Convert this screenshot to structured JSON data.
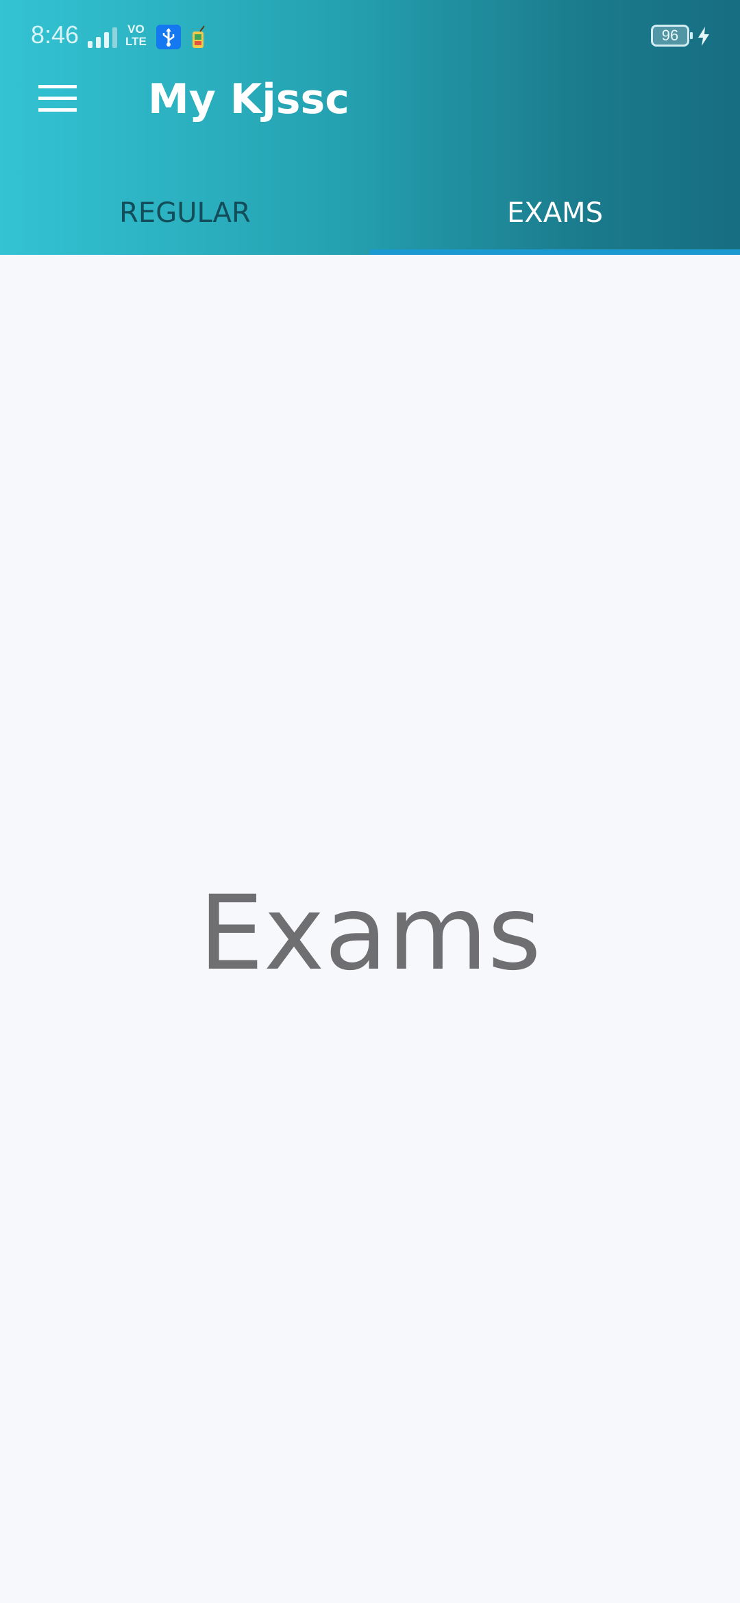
{
  "status_bar": {
    "time": "8:46",
    "network_label_top": "VO",
    "network_label_bottom": "LTE",
    "battery_level": "96",
    "icons": [
      "signal-icon",
      "usb-icon",
      "app-notification-icon",
      "battery-icon",
      "charging-icon"
    ]
  },
  "toolbar": {
    "title": "My Kjssc",
    "menu_icon": "hamburger-menu-icon"
  },
  "tabs": [
    {
      "label": "REGULAR",
      "selected": false
    },
    {
      "label": "EXAMS",
      "selected": true
    }
  ],
  "content": {
    "label": "Exams"
  },
  "colors": {
    "header_gradient_start": "#33c3d3",
    "header_gradient_end": "#176d82",
    "tab_indicator": "#1a9ad0",
    "background": "#f7f8fc",
    "content_text": "#6f6f72"
  }
}
